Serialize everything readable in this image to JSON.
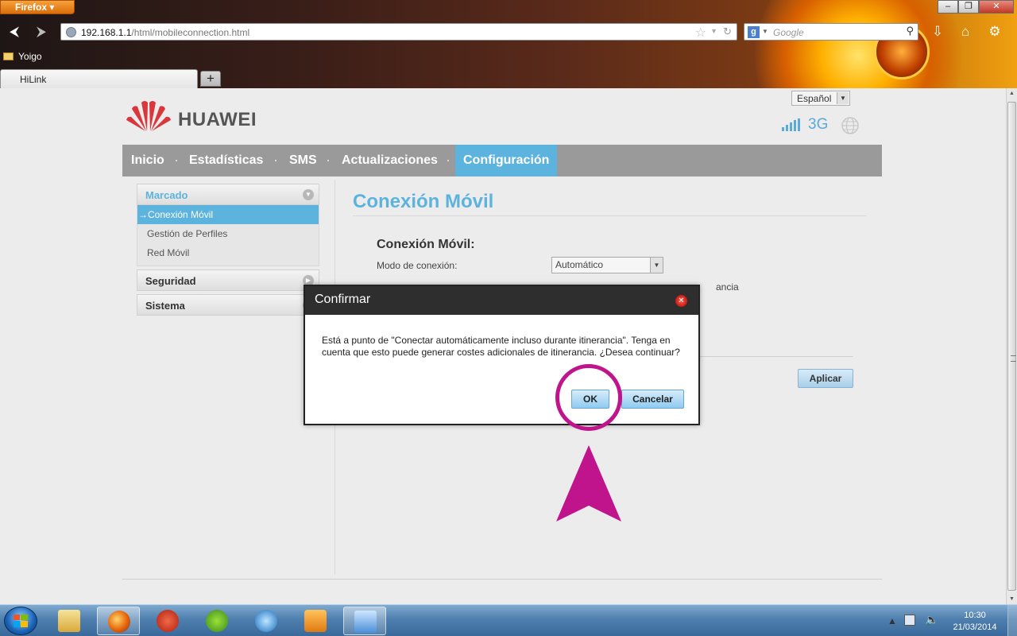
{
  "browser": {
    "app_menu_label": "Firefox",
    "url_host": "192.168.1.1",
    "url_path": "/html/mobileconnection.html",
    "search_placeholder": "Google",
    "bookmark_label": "Yoigo",
    "tab_title": "HiLink",
    "new_tab_label": "+"
  },
  "header": {
    "language": "Español",
    "brand": "HUAWEI",
    "network_type": "3G"
  },
  "nav": {
    "items": [
      {
        "label": "Inicio"
      },
      {
        "label": "Estadísticas"
      },
      {
        "label": "SMS"
      },
      {
        "label": "Actualizaciones"
      },
      {
        "label": "Configuración",
        "active": true
      }
    ]
  },
  "sidebar": {
    "sections": [
      {
        "label": "Marcado",
        "items": [
          {
            "label": "→Conexión Móvil",
            "selected": true
          },
          {
            "label": "Gestión de Perfiles"
          },
          {
            "label": "Red Móvil"
          }
        ]
      },
      {
        "label": "Seguridad"
      },
      {
        "label": "Sistema"
      }
    ]
  },
  "content": {
    "title": "Conexión Móvil",
    "form_title": "Conexión Móvil:",
    "mode_label": "Modo de conexión:",
    "mode_value": "Automático",
    "roaming_partial_text": "ancia",
    "apply_label": "Aplicar"
  },
  "dialog": {
    "title": "Confirmar",
    "message": "Está a punto de \"Conectar automáticamente incluso durante itinerancia\". Tenga en cuenta que esto puede generar costes adicionales de itinerancia. ¿Desea continuar?",
    "ok_label": "OK",
    "cancel_label": "Cancelar"
  },
  "taskbar": {
    "time": "10:30",
    "date": "21/03/2014"
  },
  "colors": {
    "accent": "#5cb3de",
    "annotation": "#c0148c",
    "nav_bg": "#9a9a9a"
  }
}
